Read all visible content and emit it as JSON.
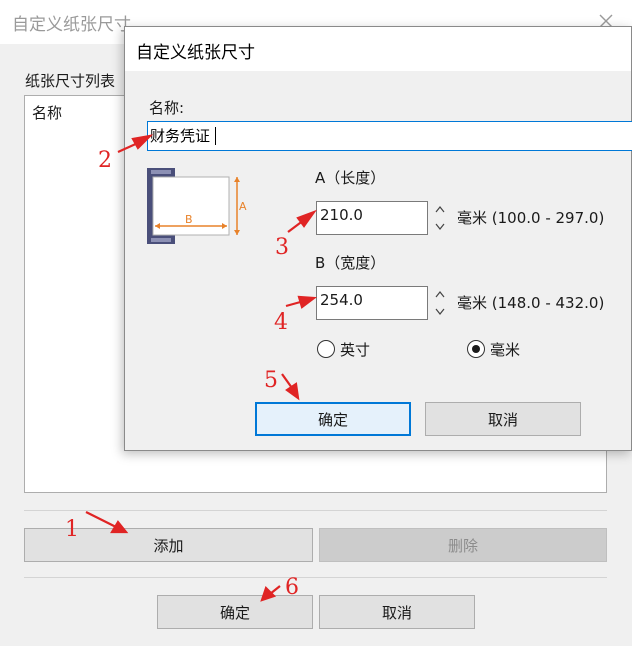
{
  "back_dialog": {
    "title": "自定义纸张尺寸",
    "list_label": "纸张尺寸列表",
    "list_column_header": "名称",
    "add_button": "添加",
    "delete_button": "删除",
    "ok_button": "确定",
    "cancel_button": "取消"
  },
  "front_dialog": {
    "title": "自定义纸张尺寸",
    "name_label": "名称:",
    "name_value": "财务凭证",
    "diagram_labels": {
      "width": "B",
      "height": "A"
    },
    "dimension_a": {
      "label": "A（长度）",
      "value": "210.0",
      "range": "毫米 (100.0 - 297.0)"
    },
    "dimension_b": {
      "label": "B（宽度）",
      "value": "254.0",
      "range": "毫米 (148.0 - 432.0)"
    },
    "units": {
      "options": [
        "英寸",
        "毫米"
      ],
      "selected": "毫米"
    },
    "ok_button": "确定",
    "cancel_button": "取消"
  },
  "annotations": [
    "1",
    "2",
    "3",
    "4",
    "5",
    "6"
  ],
  "colors": {
    "annotation": "#e02424",
    "focus_border": "#0078d7",
    "dialog_bg": "#f0f0f0",
    "diagram_accent": "#e8822a",
    "diagram_printer": "#4a4f7a"
  }
}
